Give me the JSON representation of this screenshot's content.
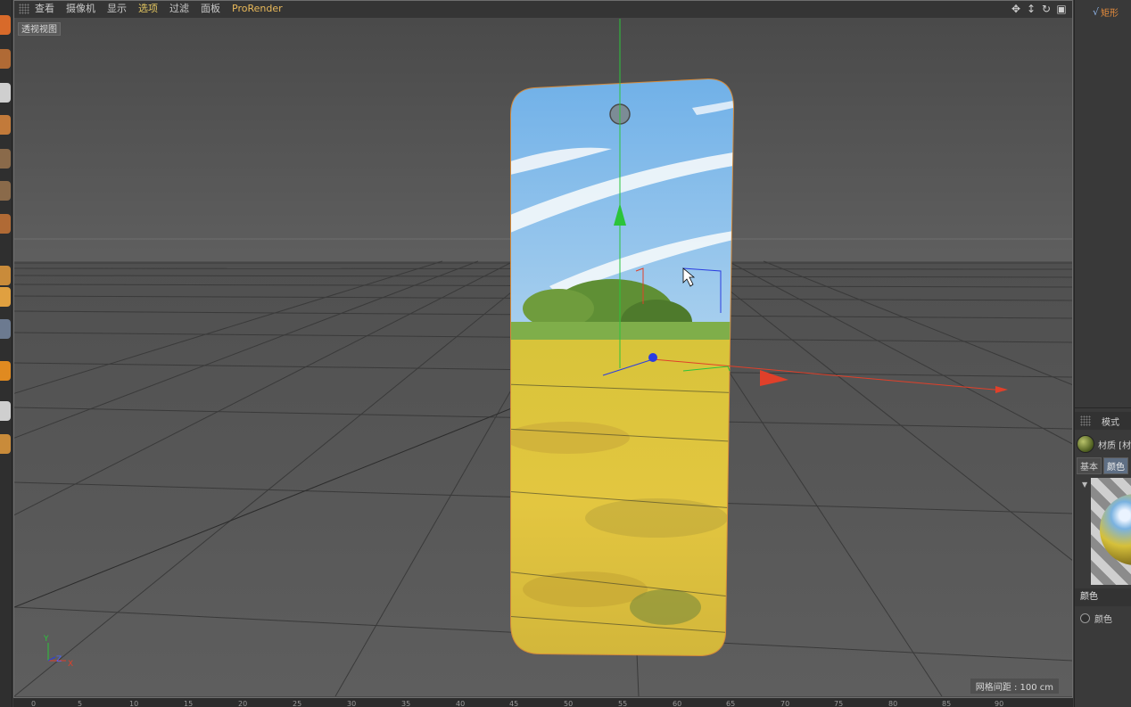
{
  "viewport": {
    "menu": [
      "查看",
      "摄像机",
      "显示",
      "选项",
      "过滤",
      "面板",
      "ProRender"
    ],
    "active_menu_index": 3,
    "view_label": "透视视图",
    "grid_spacing_label": "网格间距 : 100 cm",
    "nav_icons": [
      "move-view-icon",
      "dolly-view-icon",
      "rotate-view-icon",
      "maximize-view-icon"
    ],
    "axis_labels": {
      "y": "Y",
      "z": "Z",
      "x": "X"
    }
  },
  "timeline": {
    "ticks": [
      "0",
      "5",
      "10",
      "15",
      "20",
      "25",
      "30",
      "35",
      "40",
      "45",
      "50",
      "55",
      "60",
      "65",
      "70",
      "75",
      "80",
      "85",
      "90"
    ]
  },
  "object_manager": {
    "object_name": "矩形"
  },
  "attributes": {
    "mode_label": "模式",
    "material_label": "材质 [材",
    "tabs": [
      "基本",
      "颜色"
    ],
    "active_tab_index": 1,
    "section_label": "颜色",
    "property_label": "颜色"
  },
  "colors": {
    "accent_orange": "#e38b3c",
    "active_menu": "#e2c560",
    "axis_x": "#e0402a",
    "axis_y": "#2bc43a",
    "axis_z": "#2b3de0"
  }
}
